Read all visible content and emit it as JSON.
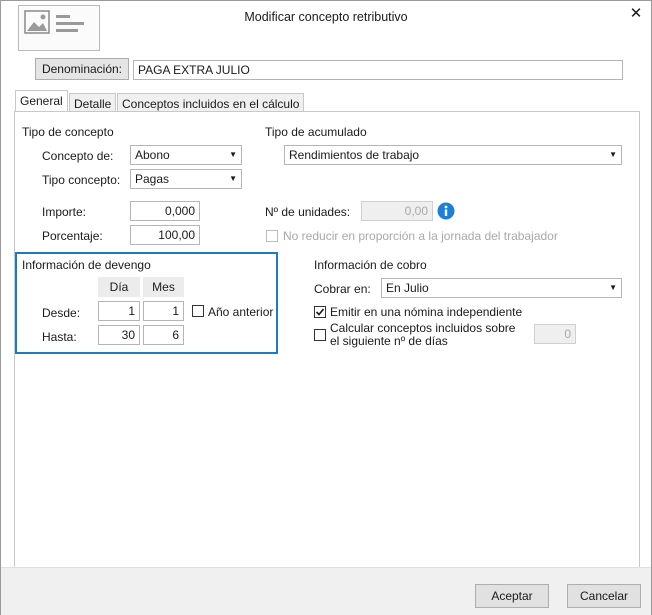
{
  "window": {
    "title": "Modificar concepto retributivo"
  },
  "denominacion": {
    "label": "Denominación:",
    "value": "PAGA EXTRA JULIO"
  },
  "tabs": [
    {
      "label": "General",
      "active": true
    },
    {
      "label": "Detalle"
    },
    {
      "label": "Conceptos incluidos en el cálculo"
    }
  ],
  "tipo_concepto": {
    "heading": "Tipo de concepto",
    "concepto_de_label": "Concepto de:",
    "concepto_de_value": "Abono",
    "tipo_label": "Tipo concepto:",
    "tipo_value": "Pagas"
  },
  "tipo_acumulado": {
    "heading": "Tipo de acumulado",
    "value": "Rendimientos de trabajo"
  },
  "importe": {
    "label": "Importe:",
    "value": "0,000"
  },
  "porcentaje": {
    "label": "Porcentaje:",
    "value": "100,00"
  },
  "unidades": {
    "label": "Nº de unidades:",
    "value": "0,00"
  },
  "no_reducir": {
    "label": "No reducir en proporción a la jornada del trabajador",
    "checked": false
  },
  "devengo": {
    "heading": "Información de devengo",
    "col_dia": "Día",
    "col_mes": "Mes",
    "desde_label": "Desde:",
    "desde_dia": "1",
    "desde_mes": "1",
    "hasta_label": "Hasta:",
    "hasta_dia": "30",
    "hasta_mes": "6",
    "ano_anterior_label": "Año anterior",
    "ano_anterior_checked": false
  },
  "cobro": {
    "heading": "Información de cobro",
    "cobrar_label": "Cobrar en:",
    "cobrar_value": "En Julio",
    "emitir_label": "Emitir en una nómina independiente",
    "emitir_checked": true,
    "calcular_label_1": "Calcular conceptos incluidos sobre",
    "calcular_label_2": "el siguiente nº de días",
    "calcular_checked": false,
    "dias_value": "0"
  },
  "footer": {
    "accept_label": "Aceptar",
    "cancel_label": "Cancelar"
  },
  "colors": {
    "accent_border": "#1f7bbf",
    "info_icon": "#1e7fd6"
  }
}
